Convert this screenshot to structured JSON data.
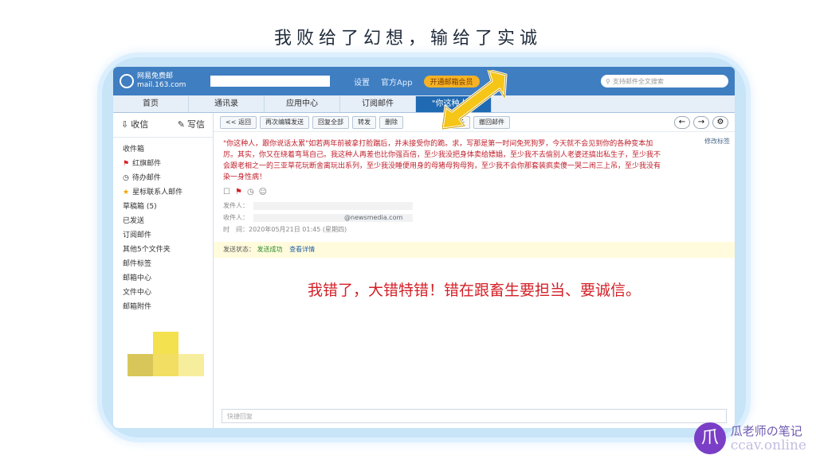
{
  "slide_title": "我败给了幻想，输给了实诚",
  "logo": {
    "text1": "网易免费邮",
    "text2": "mail.163.com"
  },
  "toplinks": [
    "设置",
    "官方App",
    "开通邮箱会员"
  ],
  "search_placeholder": "支持邮件全文搜索",
  "tabs": [
    "首页",
    "通讯录",
    "应用中心",
    "订阅邮件",
    "\"你这种人..."
  ],
  "sidebar": {
    "inbox": "收信",
    "compose": "写信",
    "folders": [
      "收件箱",
      "红旗邮件",
      "待办邮件",
      "星标联系人邮件",
      "草稿箱 (5)",
      "已发送",
      "订阅邮件",
      "其他5个文件夹",
      "邮件标签",
      "邮箱中心",
      "文件中心",
      "邮箱附件"
    ]
  },
  "toolbar": [
    "<< 返回",
    "再次编辑发送",
    "回复全部",
    "转发",
    "删除",
    "更多",
    "撤回邮件"
  ],
  "subject": "\"你这种人，跟你说话太累\"如若两年前被拿打脸踹后，并未接受你的跪。求，写那是第一时间免死狗罗，今天就不会见到你的各种变本加厉。其实，你又在绕着弯骂自己。我这种人再差也比你强百倍，至少我没把身体卖给嫖娼，至少我不去偷别人老婆还搞出私生子，至少我不会跟老相之一的三亚草花玩断舍离玩出系列，至少我没睡便用身的母猪母狗母狗，至少我不会你那套装疯卖傻一哭二闹三上吊，至少我没有染一身性病！",
  "subject_tags": "修改标签",
  "meta": {
    "from_label": "发件人：",
    "to_label": "收件人：",
    "to_domain": "@newsmedia.com",
    "time": "时　间：2020年05月21日 01:45 (星期四)"
  },
  "status": {
    "label": "发送状态：",
    "ok": "发送成功",
    "link": "查看详情"
  },
  "content": "我错了，大错特错！错在跟畜生要担当、要诚信。",
  "reply_placeholder": "快捷回复",
  "watermark": {
    "line1": "瓜老师の笔记",
    "line2": "ccav.online"
  }
}
